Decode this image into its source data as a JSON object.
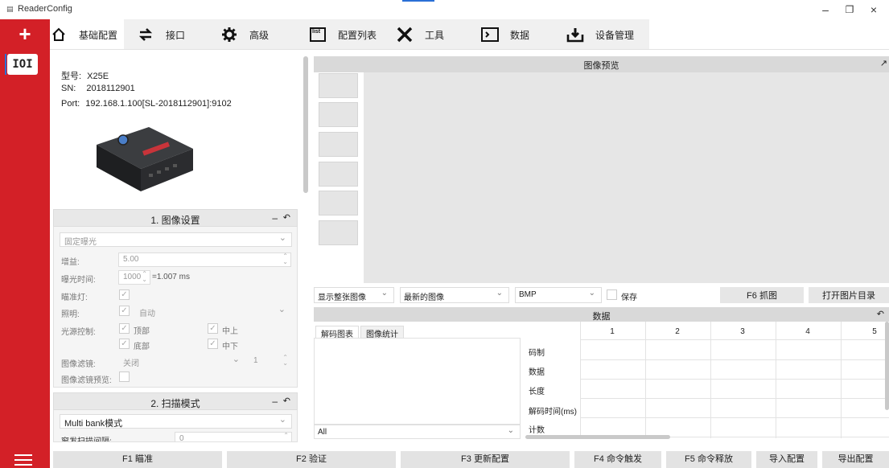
{
  "window": {
    "title": "ReaderConfig",
    "controls": [
      "–",
      "❐",
      "×"
    ]
  },
  "rail": {
    "add": "+",
    "device": "IOI"
  },
  "toolbar": {
    "tabs": [
      {
        "label": "基础配置",
        "icon": "home-icon"
      },
      {
        "label": "接口",
        "icon": "swap-icon"
      },
      {
        "label": "高级",
        "icon": "gear-icon"
      },
      {
        "label": "配置列表",
        "icon": "list-icon"
      },
      {
        "label": "工具",
        "icon": "tools-icon"
      },
      {
        "label": "数据",
        "icon": "terminal-icon"
      },
      {
        "label": "设备管理",
        "icon": "download-icon"
      }
    ],
    "list_icon_text": "list"
  },
  "device": {
    "model_label": "型号:",
    "model": "X25E",
    "sn_label": "SN:",
    "sn": "2018112901",
    "port_label": "Port:",
    "port": "192.168.1.100[SL-2018112901]:9102"
  },
  "image_settings": {
    "title": "1. 图像设置",
    "minimize": "–",
    "reset": "↶",
    "exposure_mode": "固定曝光",
    "gain_label": "增益:",
    "gain": "5.00",
    "exposure_label": "曝光时间:",
    "exposure": "1000",
    "exposure_result": "=1.007 ms",
    "aimer_label": "瞄准灯:",
    "lighting_label": "照明:",
    "lighting": "自动",
    "source_label": "光源控制:",
    "src_top": "顶部",
    "src_mid_top": "中上",
    "src_bottom": "底部",
    "src_mid_bottom": "中下",
    "filter_label": "图像滤镜:",
    "filter": "关闭",
    "filter_level": "1",
    "filter_preview_label": "图像滤镜预览:"
  },
  "scan_mode": {
    "title": "2. 扫描模式",
    "minimize": "–",
    "reset": "↶",
    "mode": "Multi bank模式",
    "interval_label": "窗发扫描间隔:",
    "interval": "0"
  },
  "preview": {
    "title": "图像预览",
    "display": "显示整张图像",
    "which": "最新的图像",
    "format": "BMP",
    "save": "保存",
    "capture": "F6 抓图",
    "open_dir": "打开图片目录"
  },
  "data_panel": {
    "title": "数据",
    "reset": "↶",
    "tab_chart": "解码图表",
    "tab_stats": "图像统计",
    "filter": "All",
    "row_labels": [
      "码制",
      "数据",
      "长度",
      "解码时间(ms)",
      "计数"
    ],
    "columns": [
      "1",
      "2",
      "3",
      "4",
      "5"
    ]
  },
  "footer": {
    "f1": "F1 瞄准",
    "f2": "F2 验证",
    "f3": "F3 更新配置",
    "f4": "F4 命令触发",
    "f5": "F5 命令释放",
    "import": "导入配置",
    "export": "导出配置"
  },
  "colors": {
    "accent": "#d32027",
    "selection": "#2a6fd6"
  }
}
